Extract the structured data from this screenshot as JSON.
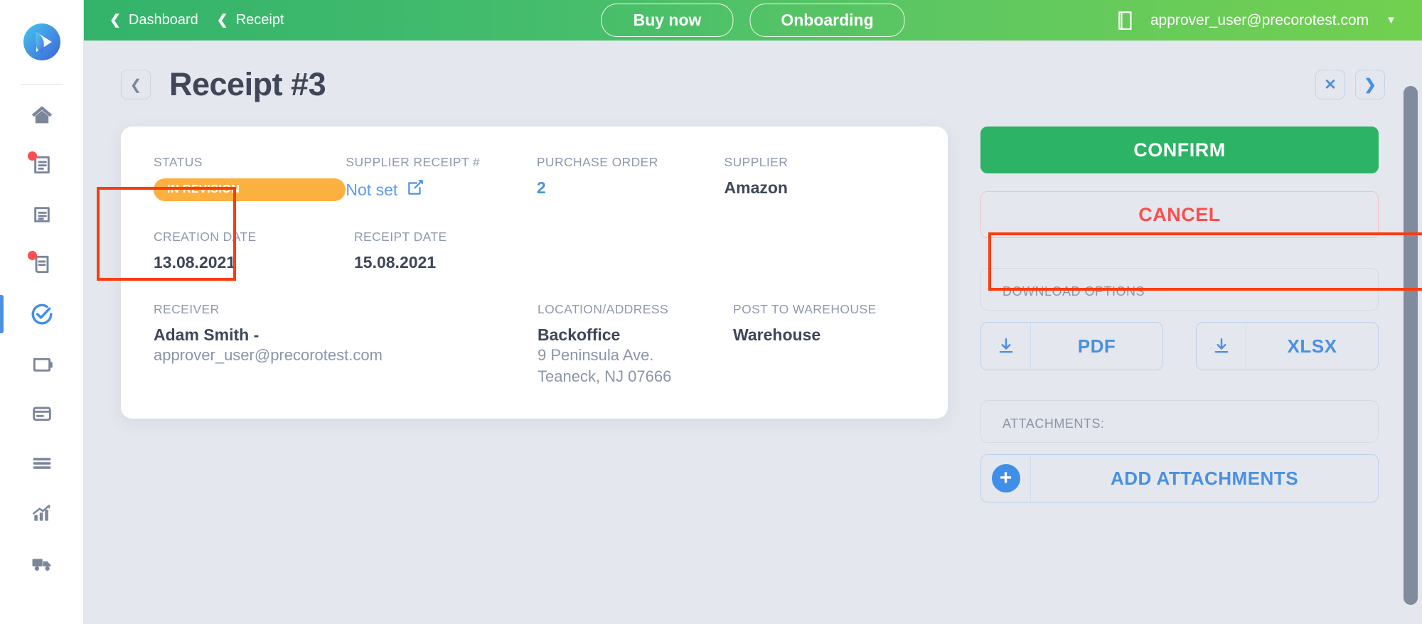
{
  "sidebar": {
    "logo_name": "precoro-logo",
    "items": [
      {
        "name": "home",
        "icon": "home-icon",
        "badge": false,
        "active": false
      },
      {
        "name": "documents",
        "icon": "document-lines-icon",
        "badge": true,
        "active": false
      },
      {
        "name": "invoices",
        "icon": "document-page-icon",
        "badge": false,
        "active": false
      },
      {
        "name": "requests",
        "icon": "receipt-icon",
        "badge": true,
        "active": false
      },
      {
        "name": "approvals",
        "icon": "check-circle-icon",
        "badge": false,
        "active": true
      },
      {
        "name": "budgets",
        "icon": "wallet-icon",
        "badge": false,
        "active": false
      },
      {
        "name": "payments",
        "icon": "card-icon",
        "badge": false,
        "active": false
      },
      {
        "name": "catalog",
        "icon": "list-icon",
        "badge": false,
        "active": false
      },
      {
        "name": "reports",
        "icon": "chart-up-icon",
        "badge": false,
        "active": false
      },
      {
        "name": "suppliers",
        "icon": "truck-icon",
        "badge": false,
        "active": false
      }
    ]
  },
  "header": {
    "breadcrumbs": [
      {
        "label": "Dashboard",
        "icon": "chevron-left-icon"
      },
      {
        "label": "Receipt",
        "icon": "chevron-left-icon"
      }
    ],
    "buy_now_label": "Buy now",
    "onboarding_label": "Onboarding",
    "book_icon": "book-icon",
    "user_email": "approver_user@precorotest.com",
    "caret_icon": "chevron-down-icon"
  },
  "page": {
    "back_icon": "chevron-left-icon",
    "title": "Receipt #3",
    "close_icon": "close-icon",
    "next_icon": "chevron-right-icon"
  },
  "card": {
    "status": {
      "label": "STATUS",
      "value": "IN REVISION",
      "color": "#fcb040"
    },
    "supplier_receipt": {
      "label": "SUPPLIER RECEIPT #",
      "value": "Not set",
      "edit_icon": "edit-square-icon"
    },
    "purchase_order": {
      "label": "PURCHASE ORDER",
      "value": "2"
    },
    "supplier": {
      "label": "SUPPLIER",
      "value": "Amazon"
    },
    "creation_date": {
      "label": "CREATION DATE",
      "value": "13.08.2021"
    },
    "receipt_date": {
      "label": "RECEIPT DATE",
      "value": "15.08.2021"
    },
    "receiver": {
      "label": "RECEIVER",
      "value": "Adam Smith -",
      "sub": "approver_user@precorotest.com"
    },
    "location": {
      "label": "LOCATION/ADDRESS",
      "value": "Backoffice",
      "line1": "9 Peninsula Ave.",
      "line2": "Teaneck, NJ 07666"
    },
    "post_to_warehouse": {
      "label": "POST TO WAREHOUSE",
      "value": "Warehouse"
    }
  },
  "actions": {
    "confirm_label": "CONFIRM",
    "cancel_label": "CANCEL",
    "download_title": "DOWNLOAD OPTIONS",
    "download_icon": "download-icon",
    "pdf_label": "PDF",
    "xlsx_label": "XLSX",
    "attachments_title": "ATTACHMENTS:",
    "add_attachments_label": "ADD ATTACHMENTS",
    "plus_icon": "plus-icon"
  },
  "annotations": {
    "status_highlight_color": "#fa3c0f",
    "cancel_highlight_color": "#fa3c0f"
  }
}
